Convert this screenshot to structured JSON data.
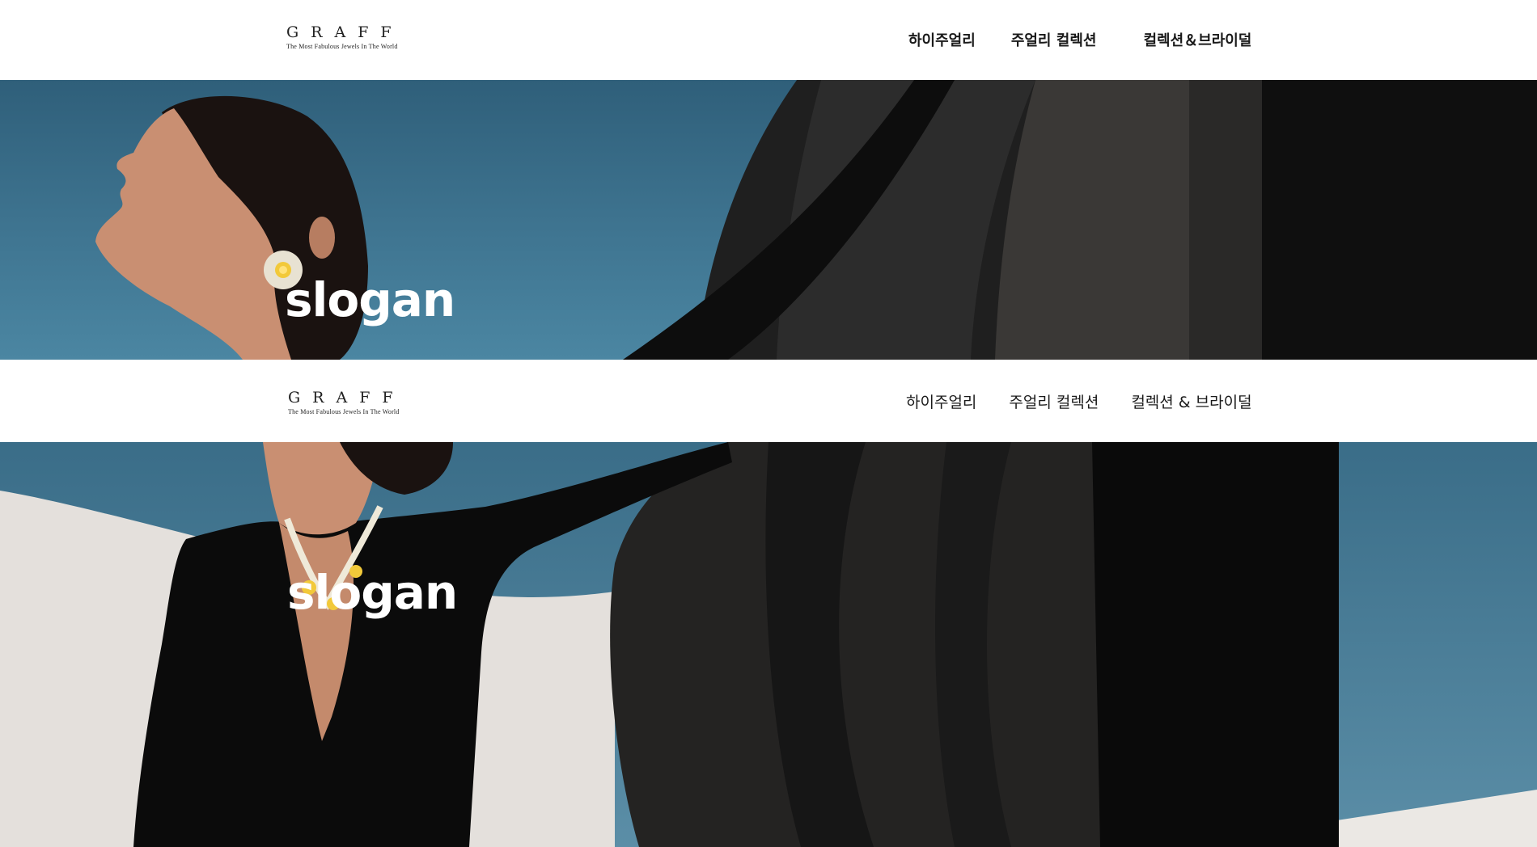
{
  "header_top": {
    "logo_word": "GRAFF",
    "logo_tagline": "The Most Fabulous Jewels In The World",
    "nav": [
      "하이주얼리",
      "주얼리 컬렉션",
      "컬렉션＆브라이덜"
    ]
  },
  "hero_top": {
    "slogan": "slogan"
  },
  "header_bottom": {
    "logo_word": "GRAFF",
    "logo_tagline": "The Most Fabulous Jewels In The World",
    "nav": [
      "하이주얼리",
      "주얼리 컬렉션",
      "컬렉션 & 브라이덜"
    ]
  },
  "hero_bottom": {
    "slogan": "slogan"
  },
  "colors": {
    "sky": "#3f7591",
    "sculpture": "#1c1c1c",
    "sand": "#e4e0dc",
    "skin": "#c98f72"
  },
  "icons": [
    "graff-logo"
  ]
}
